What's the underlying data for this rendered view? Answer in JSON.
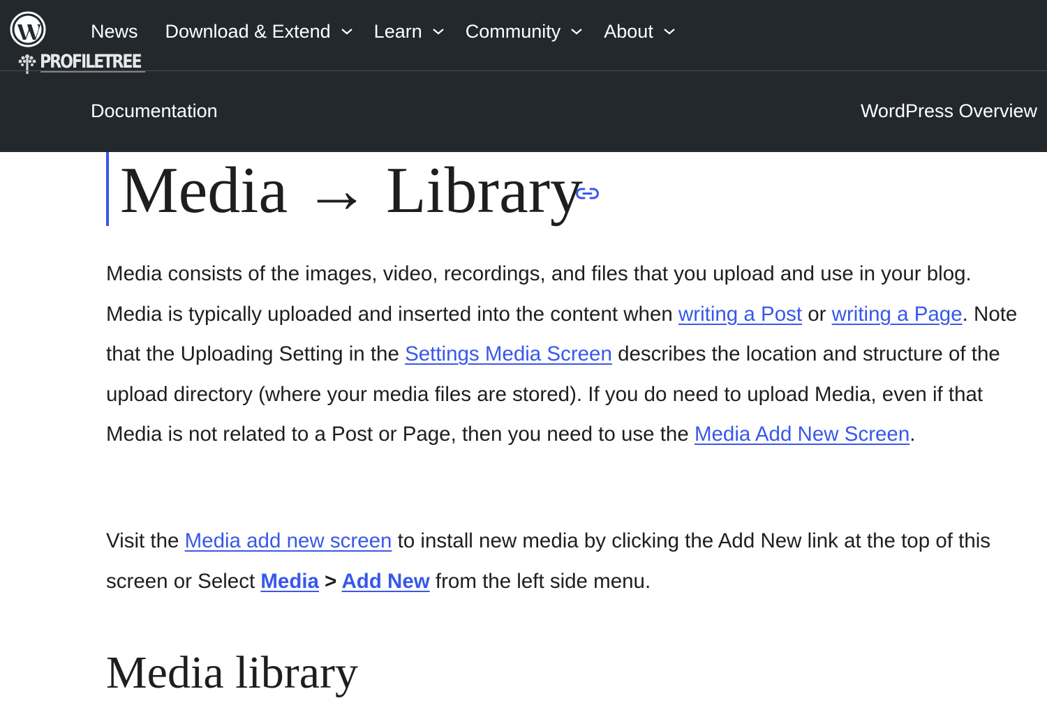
{
  "header": {
    "brand_text": "PROFILETREE",
    "nav": [
      {
        "label": "News"
      },
      {
        "label": "Download & Extend"
      },
      {
        "label": "Learn"
      },
      {
        "label": "Community"
      },
      {
        "label": "About"
      }
    ],
    "section_label": "Documentation",
    "section_right_label": "WordPress Overview"
  },
  "article": {
    "title": "Media → Library",
    "p1": {
      "t1": "Media consists of the images, video, recordings, and files that you upload and use in your blog. Media is typically uploaded and inserted into the content when ",
      "link1": "writing a Post",
      "t2": " or ",
      "link2": "writing a Page",
      "t3": ". Note that the Uploading Setting in the ",
      "link3": "Settings Media Screen",
      "t4": " describes the location and structure of the upload directory (where your media files are stored). If you do need to upload Media, even if that Media is not related to a Post or Page, then you need to use the ",
      "link4": "Media Add New Screen",
      "t5": "."
    },
    "p2": {
      "t1": "Visit the ",
      "link1": "Media add new screen",
      "t2": " to install new media by clicking the Add New link at the top of this screen or Select ",
      "link2": "Media",
      "sep": " > ",
      "link3": "Add New",
      "t3": " from the left side menu."
    },
    "subheading": "Media library"
  },
  "colors": {
    "header_bg": "#23282d",
    "link": "#3858e9",
    "text": "#1e1e1e"
  },
  "icons": [
    "wordpress-logo-icon",
    "profiletree-tree-icon",
    "chevron-down-icon",
    "anchor-link-icon"
  ]
}
